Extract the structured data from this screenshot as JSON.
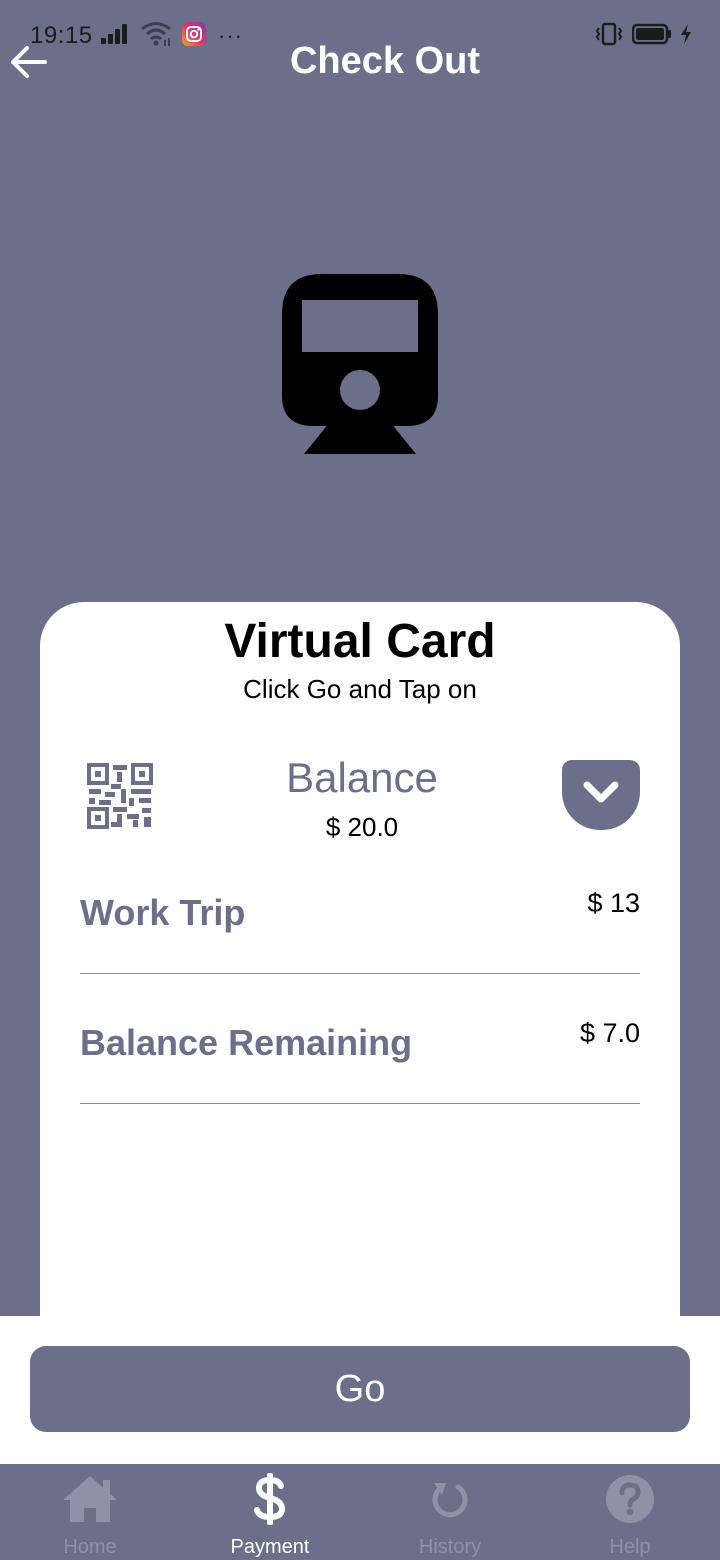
{
  "status_bar": {
    "time": "19:15",
    "dots": "···",
    "icons": [
      "signal-icon",
      "wifi-icon",
      "instagram-icon",
      "vibrate-icon",
      "battery-icon",
      "charging-icon"
    ]
  },
  "header": {
    "title": "Check Out",
    "back_icon": "arrow-left-icon"
  },
  "hero": {
    "icon": "train-icon"
  },
  "card": {
    "title": "Virtual Card",
    "subtitle": "Click Go and Tap on",
    "qr_icon": "qr-code-icon",
    "balance_label": "Balance",
    "balance_value": "$ 20.0",
    "dropdown_icon": "chevron-down-icon",
    "rows": [
      {
        "label": "Work Trip",
        "value": "$ 13"
      },
      {
        "label": "Balance Remaining",
        "value": "$ 7.0"
      }
    ]
  },
  "action": {
    "go_label": "Go"
  },
  "nav": {
    "items": [
      {
        "label": "Home",
        "icon": "home-icon",
        "active": false
      },
      {
        "label": "Payment",
        "icon": "dollar-icon",
        "active": true
      },
      {
        "label": "History",
        "icon": "history-icon",
        "active": false
      },
      {
        "label": "Help",
        "icon": "help-icon",
        "active": false
      }
    ]
  },
  "colors": {
    "primary": "#6a7089",
    "surface": "#ffffff",
    "nav_inactive": "#8d92a6",
    "text": "#000000"
  }
}
